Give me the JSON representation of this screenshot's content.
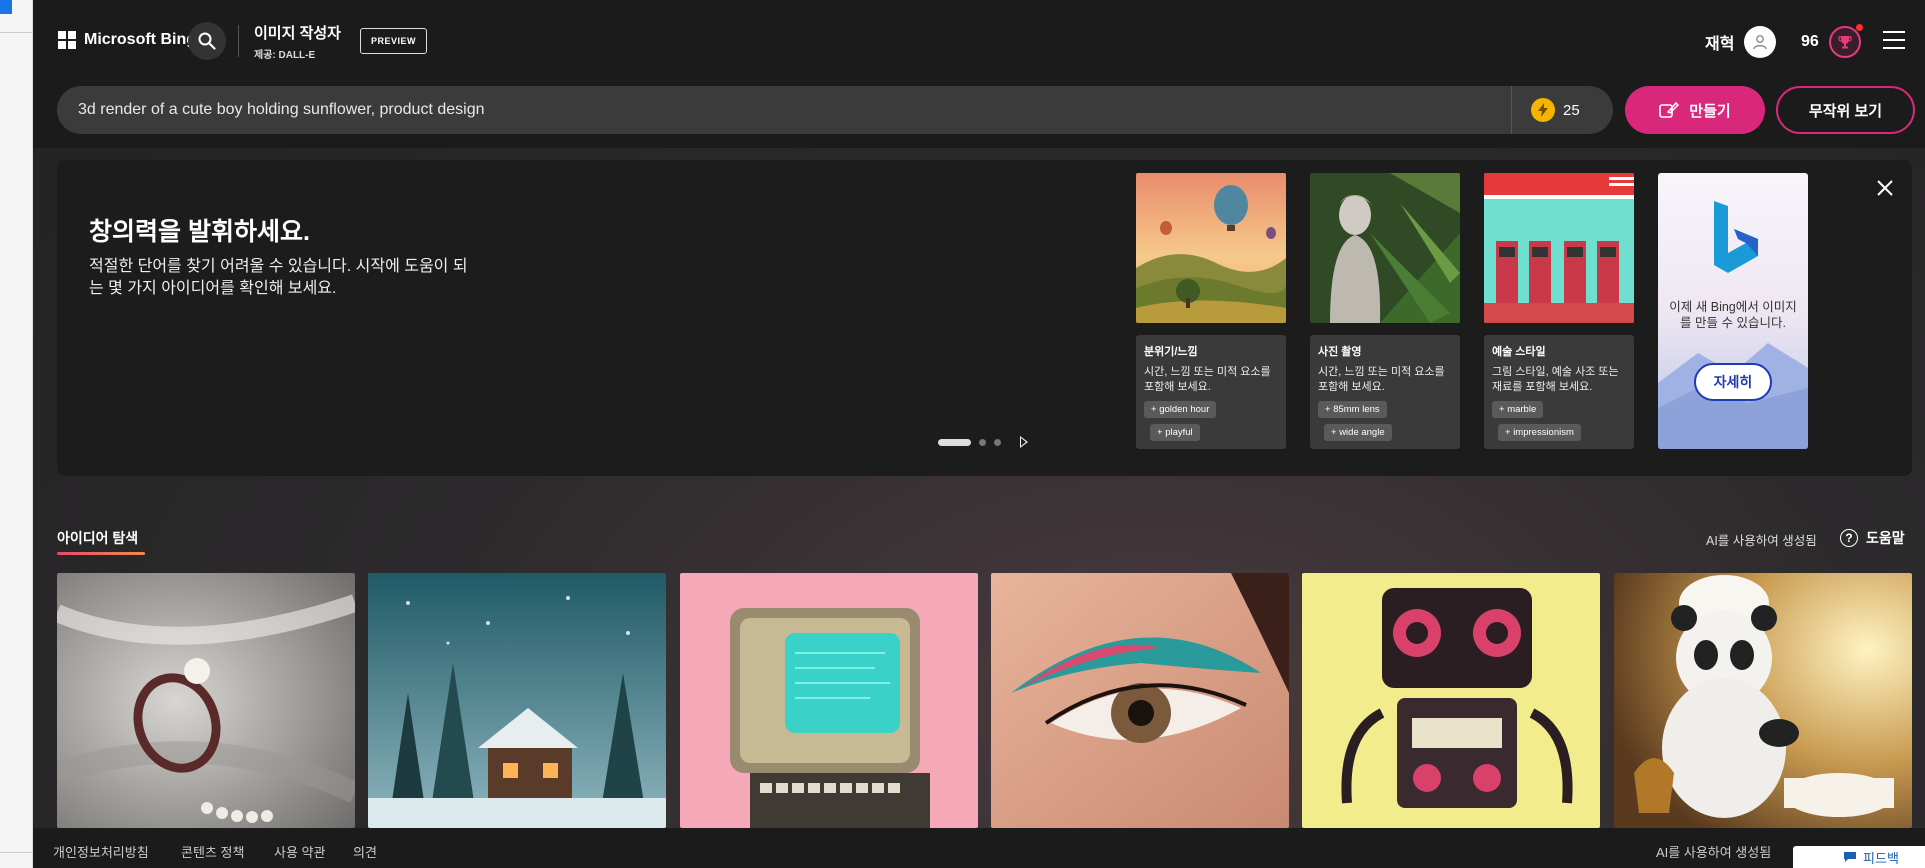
{
  "header": {
    "brand": "Microsoft Bing",
    "title": "이미지 작성자",
    "subtitle": "제공: DALL-E",
    "preview_badge": "PREVIEW",
    "user_name": "재혁",
    "points": "96"
  },
  "prompt": {
    "value": "3d render of a cute boy holding  sunflower, product design",
    "boosts": "25",
    "create_label": "만들기",
    "random_label": "무작위 보기"
  },
  "banner": {
    "title": "창의력을 발휘하세요.",
    "description": "적절한 단어를 찾기 어려울 수 있습니다. 시작에 도움이 되는 몇 가지 아이디어를 확인해 보세요.",
    "cards": [
      {
        "title": "분위기/느낌",
        "desc": "시간, 느낌 또는 미적 요소를 포함해 보세요.",
        "chip1": "golden hour",
        "chip2": "playful"
      },
      {
        "title": "사진 촬영",
        "desc": "시간, 느낌 또는 미적 요소를 포함해 보세요.",
        "chip1": "85mm lens",
        "chip2": "wide angle"
      },
      {
        "title": "예술 스타일",
        "desc": "그림 스타일, 예술 사조 또는 재료를 포함해 보세요.",
        "chip1": "marble",
        "chip2": "impressionism"
      }
    ],
    "promo": {
      "text": "이제 새 Bing에서 이미지를 만들 수 있습니다.",
      "button": "자세히"
    }
  },
  "explore": {
    "title": "아이디어 탐색",
    "ai_generated": "AI를 사용하여 생성됨",
    "help": "도움말"
  },
  "footer": {
    "links": [
      "개인정보처리방침",
      "콘텐츠 정책",
      "사용 약관",
      "의견"
    ],
    "ai_generated": "AI를 사용하여 생성됨",
    "feedback": "피드백"
  },
  "colors": {
    "accent": "#d9287b",
    "header_bg": "#1b1b1b",
    "banner_bg": "#1c1c1c"
  }
}
